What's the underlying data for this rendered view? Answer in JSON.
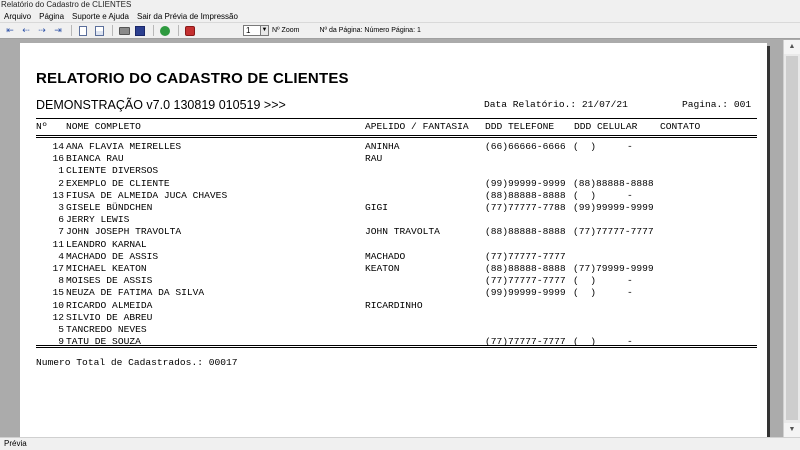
{
  "window": {
    "title": "Relatório do Cadastro de CLIENTES"
  },
  "menu": [
    "Arquivo",
    "Página",
    "Suporte e Ajuda",
    "Sair da Prévia de Impressão"
  ],
  "toolbar": {
    "zoom_value": "1",
    "zoom_label": "Nº Zoom",
    "page_info": "Nº da Página: Número Página: 1"
  },
  "report": {
    "title": "RELATORIO DO CADASTRO DE CLIENTES",
    "subtitle": "DEMONSTRAÇÃO v7.0 130819 010519 >>>",
    "date": "Data Relatório.: 21/07/21",
    "page": "Pagina.: 001",
    "headers": {
      "num": "Nº",
      "name": "NOME COMPLETO",
      "apelido": "APELIDO / FANTASIA",
      "tel": "DDD TELEFONE",
      "cel": "DDD CELULAR",
      "contato": "CONTATO"
    },
    "rows": [
      {
        "num": "14",
        "name": "ANA FLAVIA MEIRELLES",
        "apelido": "ANINHA",
        "tel": "(66)66666-6666",
        "cel": "(  )",
        "dash": "-"
      },
      {
        "num": "16",
        "name": "BIANCA RAU",
        "apelido": "RAU",
        "tel": "",
        "cel": "",
        "dash": ""
      },
      {
        "num": "1",
        "name": "CLIENTE DIVERSOS",
        "apelido": "",
        "tel": "",
        "cel": "",
        "dash": ""
      },
      {
        "num": "2",
        "name": "EXEMPLO DE CLIENTE",
        "apelido": "",
        "tel": "(99)99999-9999",
        "cel": "(88)88888-8888",
        "dash": ""
      },
      {
        "num": "13",
        "name": "FIUSA DE ALMEIDA JUCA CHAVES",
        "apelido": "",
        "tel": "(88)88888-8888",
        "cel": "(  )",
        "dash": "-"
      },
      {
        "num": "3",
        "name": "GISELE BÜNDCHEN",
        "apelido": "GIGI",
        "tel": "(77)77777-7788",
        "cel": "(99)99999-9999",
        "dash": ""
      },
      {
        "num": "6",
        "name": "JERRY LEWIS",
        "apelido": "",
        "tel": "",
        "cel": "",
        "dash": ""
      },
      {
        "num": "7",
        "name": "JOHN JOSEPH TRAVOLTA",
        "apelido": "JOHN TRAVOLTA",
        "tel": "(88)88888-8888",
        "cel": "(77)77777-7777",
        "dash": ""
      },
      {
        "num": "11",
        "name": "LEANDRO KARNAL",
        "apelido": "",
        "tel": "",
        "cel": "",
        "dash": ""
      },
      {
        "num": "4",
        "name": "MACHADO DE ASSIS",
        "apelido": "MACHADO",
        "tel": "(77)77777-7777",
        "cel": "",
        "dash": ""
      },
      {
        "num": "17",
        "name": "MICHAEL KEATON",
        "apelido": "KEATON",
        "tel": "(88)88888-8888",
        "cel": "(77)79999-9999",
        "dash": ""
      },
      {
        "num": "8",
        "name": "MOISES DE ASSIS",
        "apelido": "",
        "tel": "(77)77777-7777",
        "cel": "(  )",
        "dash": "-"
      },
      {
        "num": "15",
        "name": "NEUZA DE FATIMA DA SILVA",
        "apelido": "",
        "tel": "(99)99999-9999",
        "cel": "(  )",
        "dash": "-"
      },
      {
        "num": "10",
        "name": "RICARDO ALMEIDA",
        "apelido": "RICARDINHO",
        "tel": "",
        "cel": "",
        "dash": ""
      },
      {
        "num": "12",
        "name": "SILVIO DE ABREU",
        "apelido": "",
        "tel": "",
        "cel": "",
        "dash": ""
      },
      {
        "num": "5",
        "name": "TANCREDO NEVES",
        "apelido": "",
        "tel": "",
        "cel": "",
        "dash": ""
      },
      {
        "num": "9",
        "name": "TATU DE SOUZA",
        "apelido": "",
        "tel": "(77)77777-7777",
        "cel": "(  )",
        "dash": "-"
      }
    ],
    "footer": "Numero Total de Cadastrados.: 00017"
  },
  "status": {
    "text": "Prévia"
  }
}
